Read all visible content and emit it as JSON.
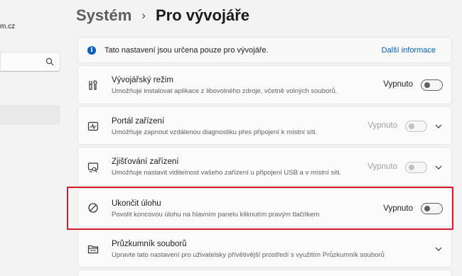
{
  "sidebar": {
    "account_email": "m.cz",
    "search_icon": "search-icon"
  },
  "header": {
    "parent": "Systém",
    "separator": "›",
    "current": "Pro vývojáře"
  },
  "info": {
    "text": "Tato nastavení jsou určena pouze pro vývojáře.",
    "link": "Další informace",
    "accent": "#005fb8"
  },
  "settings": [
    {
      "title": "Vývojářský režim",
      "description": "Umožňuje instalovat aplikace z libovolného zdroje, včetně volných souborů.",
      "state": "Vypnuto",
      "icon": "developer-tools-icon"
    },
    {
      "title": "Portál zařízení",
      "description": "Umožňuje zapnout vzdálenou diagnostiku přes připojení k místní síti.",
      "state": "Vypnuto",
      "icon": "device-portal-icon"
    },
    {
      "title": "Zjišťování zařízení",
      "description": "Umožňuje nastavit viditelnost vašeho zařízení u připojení USB a v místní síti.",
      "state": "Vypnuto",
      "icon": "device-discovery-icon"
    },
    {
      "title": "Ukončit úlohu",
      "description": "Povolit koncovou úlohu na hlavním panelu kliknutím pravým tlačítkem",
      "state": "Vypnuto",
      "icon": "end-task-icon"
    },
    {
      "title": "Průzkumník souborů",
      "description": "Upravte tato nastavení pro uživatelsky přívětivější prostředí s využitím Průzkumník souborů",
      "icon": "file-explorer-icon"
    }
  ],
  "highlight_color": "#d71a2a"
}
